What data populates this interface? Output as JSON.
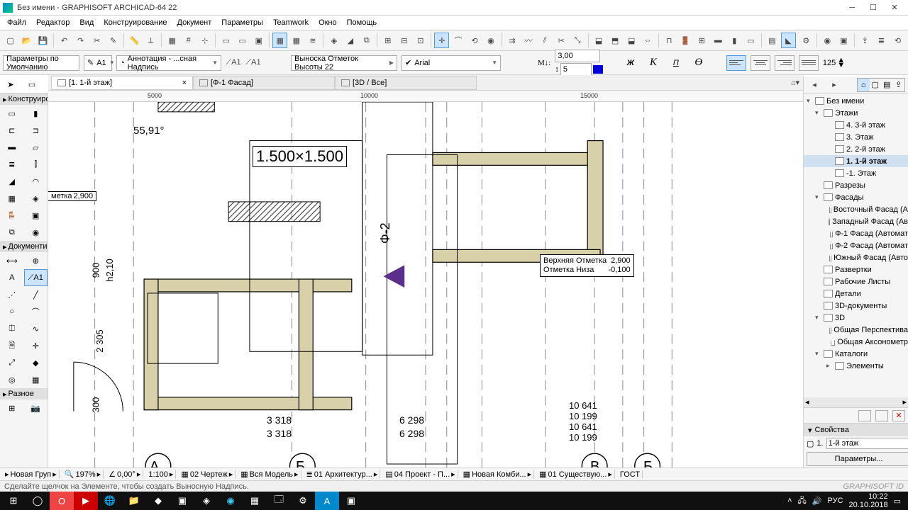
{
  "title": "Без имени - GRAPHISOFT ARCHICAD-64 22",
  "menu": [
    "Файл",
    "Редактор",
    "Вид",
    "Конструирование",
    "Документ",
    "Параметры",
    "Teamwork",
    "Окно",
    "Помощь"
  ],
  "toolbar2": {
    "defaults": "Параметры по Умолчанию",
    "layer_label": "А1",
    "annotation": "Аннотация - ...сная Надпись",
    "callout_type": "Выноска Отметок Высоты 22",
    "font": "Arial",
    "size1": "3,00",
    "size2": "5",
    "width_val": "125"
  },
  "tabs": [
    {
      "label": "[1. 1-й этаж]",
      "active": true,
      "closable": true
    },
    {
      "label": "[Ф-1 Фасад]",
      "active": false
    },
    {
      "label": "[3D / Все]",
      "active": false
    }
  ],
  "ruler": {
    "t1": "5000",
    "t2": "10000",
    "t3": "15000"
  },
  "toolbox": {
    "s1": "Конструиро",
    "s2": "Документи",
    "s3": "Разное"
  },
  "drawing": {
    "angle": "55,91°",
    "dim_box": "1.500×1.500",
    "elev_left_top": "метка",
    "elev_left_val": "2,900",
    "section_label": "Ф-2",
    "callout_r1": "Верхняя Отметка",
    "callout_r1v": "2,900",
    "callout_r2": "Отметка Низа",
    "callout_r2v": "-0,100",
    "d_900": "900",
    "d_h210": "h2,10",
    "d_2305": "2 305",
    "d_300": "300",
    "d_3318": "3 318",
    "d_6298": "6 298",
    "d_10641": "10 641",
    "d_10199": "10 199",
    "axis_a": "А",
    "axis_b": "Б",
    "axis_v": "В"
  },
  "navigator": {
    "root": "Без имени",
    "stories_head": "Этажи",
    "stories": [
      "4. 3-й этаж",
      "3. Этаж",
      "2. 2-й этаж",
      "1. 1-й этаж",
      "-1. Этаж"
    ],
    "sections": "Разрезы",
    "facades_head": "Фасады",
    "facades": [
      "Восточный Фасад (А",
      "Западный Фасад (Ав",
      "Ф-1 Фасад (Автомат",
      "Ф-2 Фасад (Автомат",
      "Южный Фасад (Авто"
    ],
    "razvertki": "Развертки",
    "worksheets": "Рабочие Листы",
    "details": "Детали",
    "docs3d": "3D-документы",
    "view3d": "3D",
    "persp": "Общая Перспектива",
    "axon": "Общая Аксонометр",
    "catalogs": "Каталоги",
    "elements": "Элементы",
    "props_head": "Свойства",
    "props_floor": "1.",
    "props_floor_val": "1-й этаж",
    "params_btn": "Параметры..."
  },
  "quickbar": {
    "newgroup": "Новая Груп",
    "zoom": "197%",
    "angle": "0,00°",
    "scale": "1:100",
    "q1": "02 Чертеж",
    "q2": "Вся Модель",
    "q3": "01 Архитектур...",
    "q4": "04 Проект - П...",
    "q5": "Новая Комби...",
    "q6": "01 Существую...",
    "gost": "ГОСТ"
  },
  "hint": "Сделайте щелчок на Элементе, чтобы создать Выносную Надпись.",
  "brand": "GRAPHISOFT ID",
  "tray": {
    "lang": "РУС",
    "time": "10:22",
    "date": "20.10.2018"
  }
}
